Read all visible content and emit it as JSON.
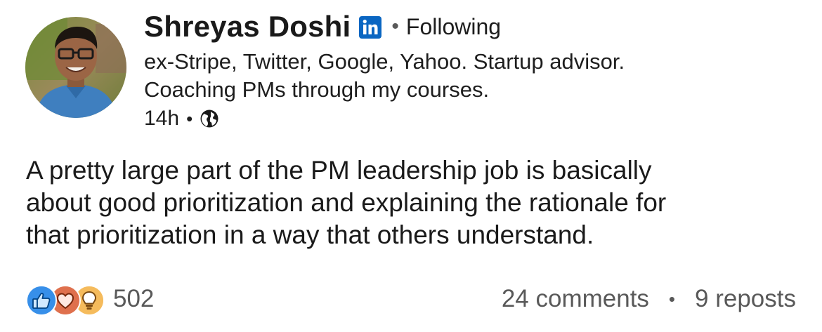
{
  "author": {
    "name": "Shreyas Doshi",
    "badge_icon": "linkedin-icon",
    "follow_status": "Following",
    "headline_line1": "ex-Stripe, Twitter, Google, Yahoo. Startup advisor.",
    "headline_line2": "Coaching PMs through my courses.",
    "posted_ago": "14h",
    "visibility_icon": "globe-icon"
  },
  "post": {
    "text_line1": "A pretty large part of the PM leadership job is basically",
    "text_line2": "about good prioritization and explaining the rationale for",
    "text_line3": "that prioritization in a way that others understand."
  },
  "social": {
    "reaction_icons": [
      "like-icon",
      "love-icon",
      "insightful-icon"
    ],
    "reaction_count": "502",
    "comments": "24 comments",
    "reposts": "9 reposts"
  },
  "colors": {
    "linkedin_blue": "#0a66c2",
    "like": "#378fe9",
    "love": "#df704d",
    "insightful": "#f5bb5c",
    "muted_text": "#595959"
  }
}
